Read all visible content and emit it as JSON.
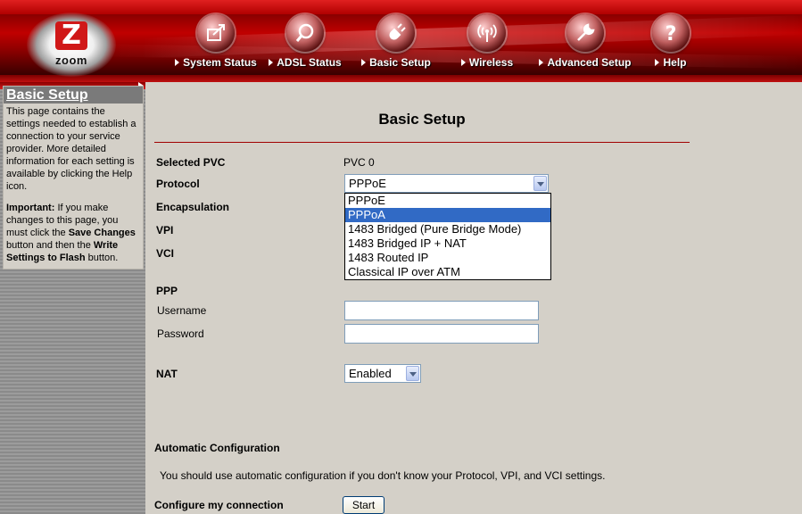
{
  "header": {
    "brand": {
      "letter": "Z",
      "word": "zoom"
    },
    "nav": [
      {
        "label": "System Status",
        "icon": "system-status-icon"
      },
      {
        "label": "ADSL Status",
        "icon": "magnifier-icon"
      },
      {
        "label": "Basic Setup",
        "icon": "plug-icon"
      },
      {
        "label": "Wireless",
        "icon": "wireless-icon"
      },
      {
        "label": "Advanced Setup",
        "icon": "wrench-icon"
      },
      {
        "label": "Help",
        "icon": "question-icon"
      }
    ]
  },
  "sidebar": {
    "title": "Basic Setup",
    "intro": "This page contains the settings needed to establish a connection to your service provider. More detailed information for each setting is available by clicking the Help icon.",
    "important_label": "Important:",
    "important_pre": " If you make changes to this page, you must click the ",
    "save_changes": "Save Changes",
    "important_mid": " button and then the ",
    "write_settings": "Write Settings to Flash",
    "important_post": " button."
  },
  "main": {
    "title": "Basic Setup",
    "selected_pvc_label": "Selected PVC",
    "selected_pvc_value": "PVC 0",
    "protocol_label": "Protocol",
    "protocol_value": "PPPoE",
    "protocol_options": [
      "PPPoE",
      "PPPoA",
      "1483 Bridged (Pure Bridge Mode)",
      "1483 Bridged IP + NAT",
      "1483 Routed IP",
      "Classical IP over ATM"
    ],
    "protocol_highlighted": "PPPoA",
    "encapsulation_label": "Encapsulation",
    "vpi_label": "VPI",
    "vci_label": "VCI",
    "ppp_label": "PPP",
    "username_label": "Username",
    "username_value": "",
    "password_label": "Password",
    "password_value": "",
    "nat_label": "NAT",
    "nat_value": "Enabled",
    "auto_config_label": "Automatic Configuration",
    "auto_config_text": "You should use automatic configuration if you don't know your Protocol, VPI, and VCI settings.",
    "configure_label": "Configure my connection",
    "start_button": "Start"
  },
  "colors": {
    "header_red": "#c00000",
    "divider_red": "#a00000",
    "highlight_blue": "#316ac5",
    "page_gray": "#d4d0c8"
  }
}
